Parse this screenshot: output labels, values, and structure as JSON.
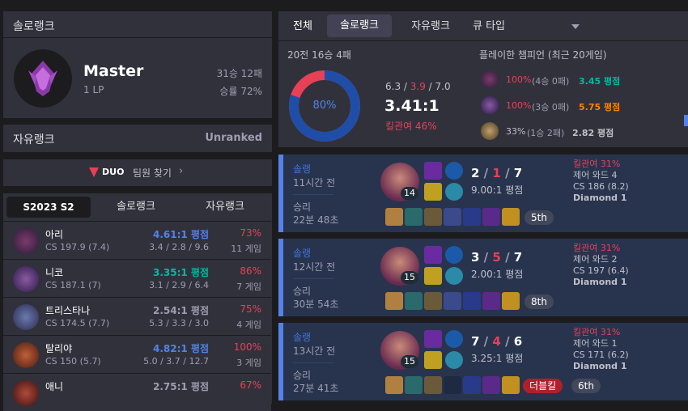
{
  "solo_rank": {
    "header": "솔로랭크",
    "tier": "Master",
    "lp": "1 LP",
    "record": "31승 12패",
    "winrate": "승률 72%"
  },
  "flex_rank": {
    "label": "자유랭크",
    "value": "Unranked"
  },
  "duo": {
    "badge": "DUO",
    "label": "팀원 찾기"
  },
  "season_tabs": [
    "S2023 S2",
    "솔로랭크",
    "자유랭크"
  ],
  "champions": [
    {
      "name": "아리",
      "cs": "CS 197.9 (7.4)",
      "kda": "4.61:1 평점",
      "kda_color": "#5383e8",
      "kd": "3.4 / 2.8 / 9.6",
      "winrate": "73%",
      "games": "11 게임"
    },
    {
      "name": "니코",
      "cs": "CS 187.1 (7)",
      "kda": "3.35:1 평점",
      "kda_color": "#00bba3",
      "kd": "3.1 / 2.9 / 6.4",
      "winrate": "86%",
      "games": "7 게임"
    },
    {
      "name": "트리스타나",
      "cs": "CS 174.5 (7.7)",
      "kda": "2.54:1 평점",
      "kda_color": "#9e9eb1",
      "kd": "5.3 / 3.3 / 3.0",
      "winrate": "75%",
      "games": "4 게임"
    },
    {
      "name": "탈리야",
      "cs": "CS 150 (5.7)",
      "kda": "4.82:1 평점",
      "kda_color": "#5383e8",
      "kd": "5.0 / 3.7 / 12.7",
      "winrate": "100%",
      "games": "3 게임"
    },
    {
      "name": "애니",
      "cs": "",
      "kda": "2.75:1 평점",
      "kda_color": "#9e9eb1",
      "kd": "",
      "winrate": "67%",
      "games": ""
    }
  ],
  "top_tabs": [
    "전체",
    "솔로랭크",
    "자유랭크",
    "큐 타입"
  ],
  "summary": {
    "record": "20전 16승 4패",
    "winrate": "80%",
    "win_fraction": 0.8,
    "kda_k": "6.3",
    "kda_d": "3.9",
    "kda_a": "7.0",
    "ratio": "3.41:1",
    "kp": "킬관여 46%",
    "played_header": "플레이한 챔피언 (최근 20게임)",
    "played": [
      {
        "pct": "100%",
        "detail": "(4승 0패)",
        "kda": "3.45 평점",
        "pct_color": "#e84057",
        "kda_color": "#00bba3"
      },
      {
        "pct": "100%",
        "detail": "(3승 0패)",
        "kda": "5.75 평점",
        "pct_color": "#e84057",
        "kda_color": "#ff8200"
      },
      {
        "pct": "33%",
        "detail": "(1승 2패)",
        "kda": "2.82 평점",
        "pct_color": "#c0c0c8",
        "kda_color": "#c0c0c8"
      }
    ]
  },
  "matches": [
    {
      "queue": "솔랭",
      "ago": "11시간 전",
      "result": "승리",
      "duration": "22분 48초",
      "level": "14",
      "k": "2",
      "d": "1",
      "a": "7",
      "ratio": "9.00:1 평점",
      "kp": "킬관여 31%",
      "wards": "제어 와드 4",
      "cs": "CS 186 (8.2)",
      "tier": "Diamond 1",
      "badge": "",
      "place": "5th"
    },
    {
      "queue": "솔랭",
      "ago": "12시간 전",
      "result": "승리",
      "duration": "30분 54초",
      "level": "15",
      "k": "3",
      "d": "5",
      "a": "7",
      "ratio": "2.00:1 평점",
      "kp": "킬관여 31%",
      "wards": "제어 와드 2",
      "cs": "CS 197 (6.4)",
      "tier": "Diamond 1",
      "badge": "",
      "place": "8th"
    },
    {
      "queue": "솔랭",
      "ago": "13시간 전",
      "result": "승리",
      "duration": "27분 41초",
      "level": "15",
      "k": "7",
      "d": "4",
      "a": "6",
      "ratio": "3.25:1 평점",
      "kp": "킬관여 31%",
      "wards": "제어 와드 1",
      "cs": "CS 171 (6.2)",
      "tier": "Diamond 1",
      "badge": "더블킬",
      "place": "6th"
    }
  ]
}
